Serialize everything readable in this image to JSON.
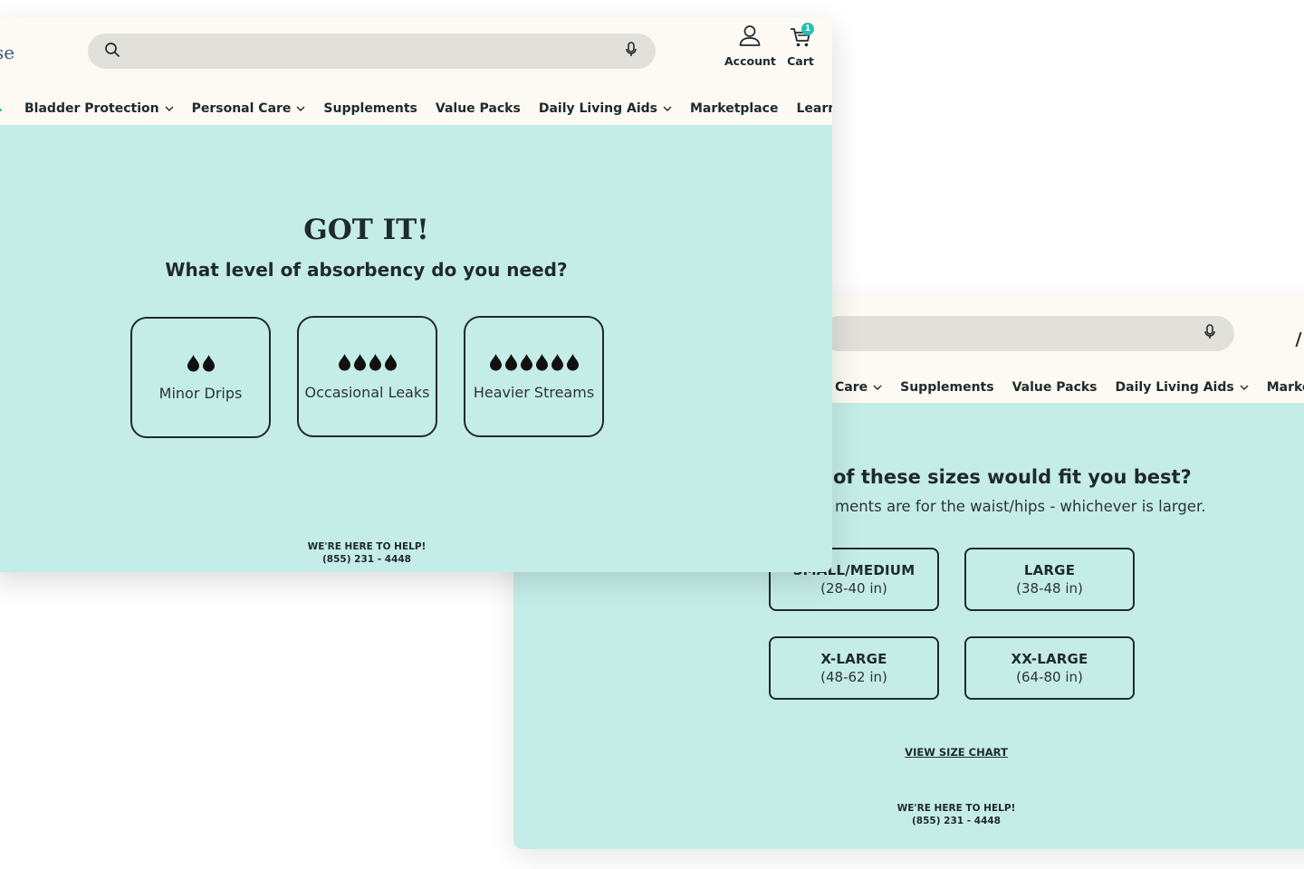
{
  "back": {
    "nav": [
      {
        "label": "Care",
        "has_chevron": true
      },
      {
        "label": "Supplements",
        "has_chevron": false
      },
      {
        "label": "Value Packs",
        "has_chevron": false
      },
      {
        "label": "Daily Living Aids",
        "has_chevron": true
      },
      {
        "label": "Marketplace",
        "has_chevron": false
      }
    ],
    "question": "of these sizes would fit you best?",
    "subtext": "ments are for the waist/hips - whichever is larger.",
    "sizes": [
      {
        "name": "SMALL/MEDIUM",
        "range": "(28-40 in)"
      },
      {
        "name": "LARGE",
        "range": "(38-48 in)"
      },
      {
        "name": "X-LARGE",
        "range": "(48-62 in)"
      },
      {
        "name": "XX-LARGE",
        "range": "(64-80 in)"
      }
    ],
    "size_chart_link": "VIEW SIZE CHART",
    "help_line": "WE'RE HERE TO HELP!",
    "phone": "(855) 231 - 4448"
  },
  "front": {
    "logo_fragment": "se",
    "account_label": "Account",
    "cart_label": "Cart",
    "cart_count": "1",
    "nav": [
      {
        "label": "Bladder Protection",
        "has_chevron": true
      },
      {
        "label": "Personal Care",
        "has_chevron": true
      },
      {
        "label": "Supplements",
        "has_chevron": false
      },
      {
        "label": "Value Packs",
        "has_chevron": false
      },
      {
        "label": "Daily Living Aids",
        "has_chevron": true
      },
      {
        "label": "Marketplace",
        "has_chevron": false
      },
      {
        "label": "Learn",
        "has_chevron": true
      }
    ],
    "heading": "GOT IT!",
    "question": "What level of absorbency do you need?",
    "options": [
      {
        "label": "Minor Drips",
        "drops": 2
      },
      {
        "label": "Occasional Leaks",
        "drops": 4
      },
      {
        "label": "Heavier Streams",
        "drops": 6
      }
    ],
    "help_line": "WE'RE HERE TO HELP!",
    "phone": "(855) 231 - 4448"
  },
  "colors": {
    "teal_bg": "#c5ede8",
    "header_bg": "#fcfaf3",
    "search_bg": "#e2e0da",
    "ink": "#1f2a2a",
    "cart_badge": "#2bbfb3"
  }
}
